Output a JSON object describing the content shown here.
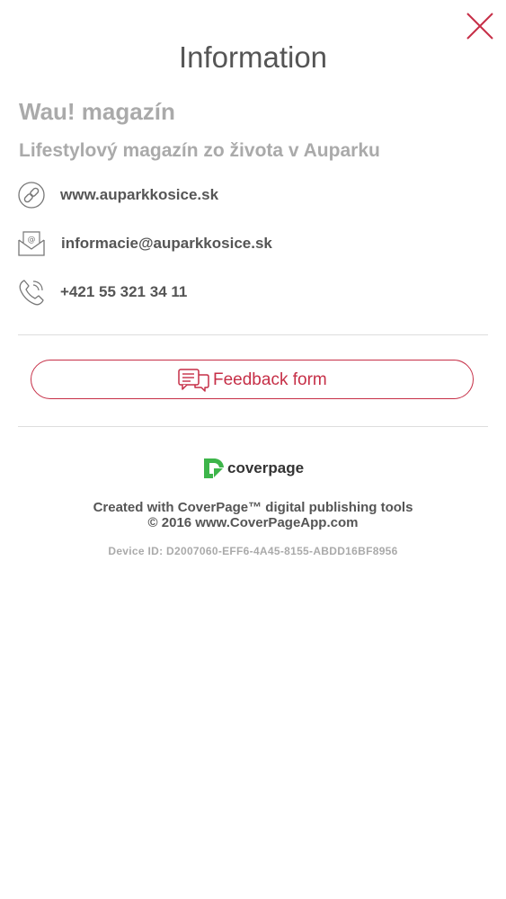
{
  "header": {
    "title": "Information",
    "close_icon": "close-x-icon"
  },
  "magazine": {
    "name": "Wau! magazín",
    "subtitle": "Lifestylový magazín zo života v Auparku"
  },
  "contacts": [
    {
      "icon": "link-icon",
      "text": "www.auparkkosice.sk"
    },
    {
      "icon": "envelope-at-icon",
      "text": "informacie@auparkkosice.sk"
    },
    {
      "icon": "phone-icon",
      "text": "+421 55 321 34 11"
    }
  ],
  "feedback": {
    "icon": "chat-bubbles-icon",
    "label": "Feedback form"
  },
  "footer": {
    "logo_text": "coverpage",
    "line1": "Created with CoverPage™ digital publishing tools",
    "line2": "© 2016 www.CoverPageApp.com",
    "device_id_label": "Device ID:",
    "device_id_value": "D2007060-EFF6-4A45-8155-ABDD16BF8956"
  },
  "colors": {
    "accent": "#c62f47",
    "text": "#555555",
    "muted": "#aaaaaa",
    "divider": "#dddddd",
    "logo_green": "#3db54a"
  }
}
